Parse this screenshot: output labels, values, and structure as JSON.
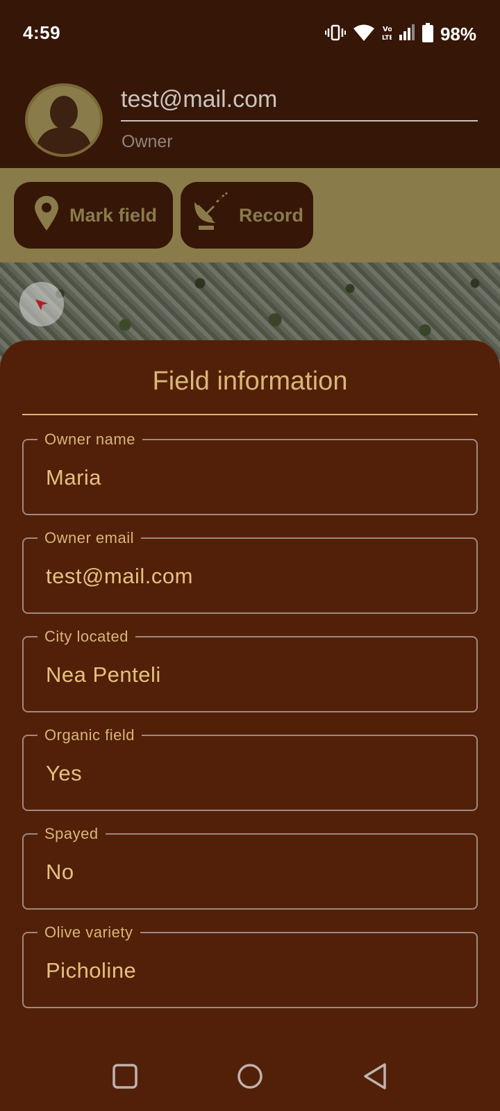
{
  "status_bar": {
    "time": "4:59",
    "battery": "98%",
    "icons": [
      "vibrate-icon",
      "wifi-icon",
      "volte-icon",
      "signal-icon",
      "battery-icon"
    ]
  },
  "account": {
    "email": "test@mail.com",
    "role": "Owner",
    "avatar_icon": "person-silhouette-icon"
  },
  "toolbar": {
    "mark_field_label": "Mark field",
    "mark_field_icon": "location-pin-icon",
    "record_label": "Record",
    "record_icon": "satellite-dish-icon"
  },
  "map": {
    "compass_icon": "compass-icon"
  },
  "sheet": {
    "title": "Field information",
    "fields": [
      {
        "label": "Owner name",
        "value": "Maria"
      },
      {
        "label": "Owner email",
        "value": "test@mail.com"
      },
      {
        "label": "City located",
        "value": "Nea Penteli"
      },
      {
        "label": "Organic field",
        "value": "Yes"
      },
      {
        "label": "Spayed",
        "value": "No"
      },
      {
        "label": "Olive variety",
        "value": "Picholine"
      }
    ]
  },
  "nav": {
    "recent_icon": "square-recent-apps-icon",
    "home_icon": "circle-home-icon",
    "back_icon": "triangle-back-icon"
  },
  "colors": {
    "status_bg": "#361607",
    "toolbar_bg": "#8a7b4b",
    "sheet_bg": "#522009",
    "accent": "#d9b677"
  }
}
